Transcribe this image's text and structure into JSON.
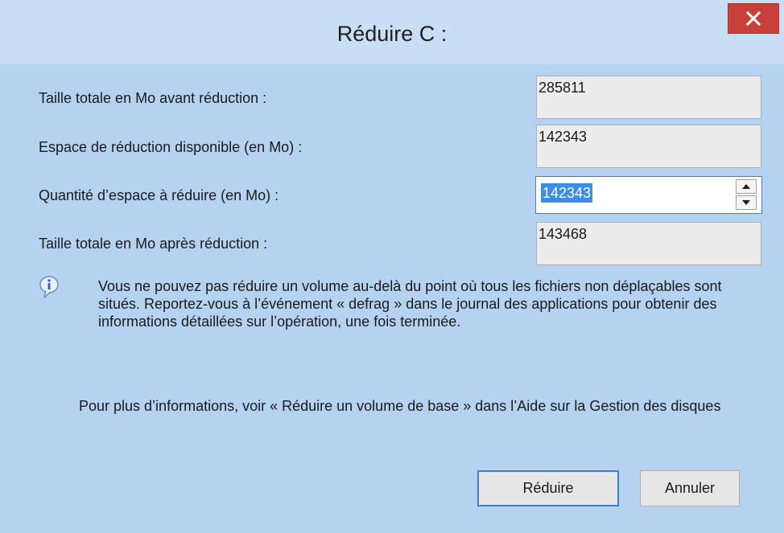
{
  "window": {
    "title": "Réduire C :"
  },
  "fields": [
    {
      "label": "Taille totale en Mo avant réduction :",
      "value": "285811"
    },
    {
      "label": "Espace de réduction disponible (en Mo) :",
      "value": "142343"
    },
    {
      "label": "Quantité d’espace à réduire (en Mo) :",
      "value": "142343"
    },
    {
      "label": "Taille totale en Mo après réduction :",
      "value": "143468"
    }
  ],
  "info": {
    "icon": "info-icon",
    "message": "Vous ne pouvez pas réduire un volume au-delà du point où tous les fichiers non déplaçables sont situés. Reportez-vous à l’événement « defrag » dans le journal des applications pour obtenir des informations détaillées sur l’opération, une fois terminée."
  },
  "help": {
    "text": "Pour plus d’informations, voir « Réduire un volume de base » dans l’Aide sur la Gestion des disques"
  },
  "buttons": {
    "reduce_label": "Réduire",
    "cancel_label": "Annuler"
  },
  "colors": {
    "titlebar": "#c7def5",
    "close_button": "#c7403a",
    "dialog_background": "#f0f0f0",
    "selection": "#3b8ee3",
    "focus_border": "#3c7fd4"
  }
}
